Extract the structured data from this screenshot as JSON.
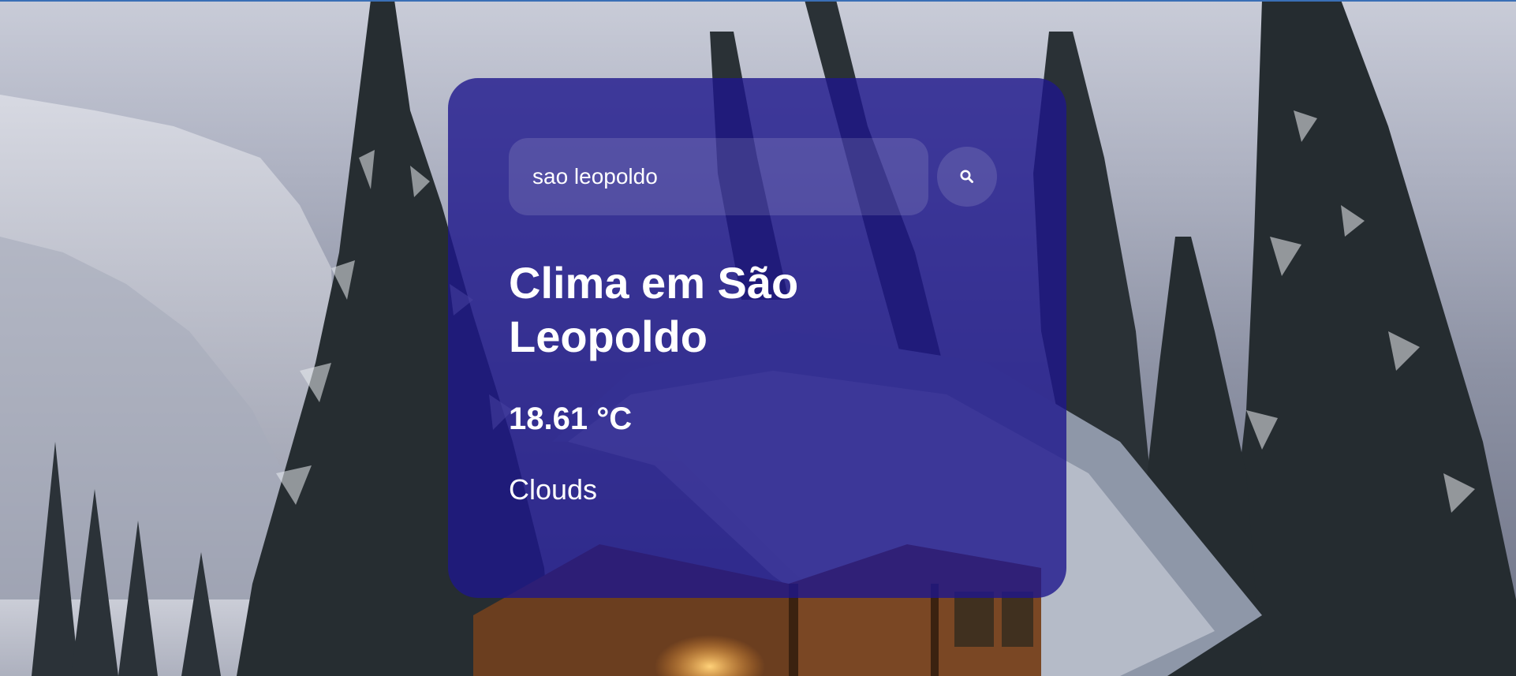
{
  "search": {
    "value": "sao leopoldo",
    "placeholder": "",
    "button_icon": "search-icon"
  },
  "weather": {
    "title": "Clima em São Leopoldo",
    "temperature": "18.61 °C",
    "description": "Clouds"
  },
  "colors": {
    "card": "#1e168c",
    "text": "#ffffff",
    "top_strip": "#3a6fb6"
  },
  "background": {
    "icon": "winter-forest-cabin-scene"
  }
}
